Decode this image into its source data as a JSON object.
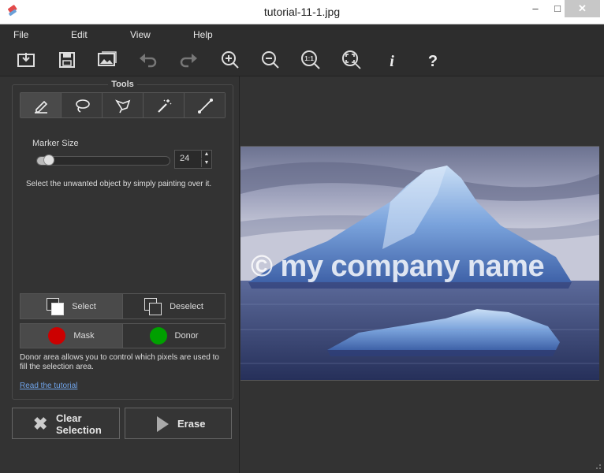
{
  "window": {
    "title": "tutorial-11-1.jpg",
    "minimize": "–",
    "maximize": "□",
    "close": "✕"
  },
  "menu": {
    "file": "File",
    "edit": "Edit",
    "view": "View",
    "help": "Help"
  },
  "toolbar": {
    "buttons": [
      {
        "name": "open-icon"
      },
      {
        "name": "save-icon"
      },
      {
        "name": "image-icon"
      },
      {
        "name": "undo-icon"
      },
      {
        "name": "redo-icon"
      },
      {
        "name": "zoom-in-icon"
      },
      {
        "name": "zoom-out-icon"
      },
      {
        "name": "zoom-actual-icon"
      },
      {
        "name": "zoom-fit-icon"
      },
      {
        "name": "info-icon"
      },
      {
        "name": "help-icon"
      }
    ],
    "zoom_actual_text": "1:1",
    "info_text": "i",
    "help_text": "?"
  },
  "tools": {
    "title": "Tools",
    "items": [
      {
        "name": "marker-tool",
        "icon": "pencil-icon",
        "active": true
      },
      {
        "name": "lasso-tool",
        "icon": "lasso-icon"
      },
      {
        "name": "polygon-lasso-tool",
        "icon": "polygon-lasso-icon"
      },
      {
        "name": "magic-wand-tool",
        "icon": "magic-wand-icon"
      },
      {
        "name": "line-tool",
        "icon": "line-icon"
      }
    ],
    "marker_size_label": "Marker Size",
    "marker_size_value": "24",
    "marker_size_fraction": 0.05,
    "hint": "Select the unwanted object by simply painting over it.",
    "select_label": "Select",
    "deselect_label": "Deselect",
    "mask_label": "Mask",
    "donor_label": "Donor",
    "mask_color": "#cc0000",
    "donor_color": "#00a000",
    "donor_text": "Donor area allows you to control which pixels are used to fill the selection area.",
    "tutorial_link": "Read the tutorial"
  },
  "actions": {
    "clear_line1": "Clear",
    "clear_line2": "Selection",
    "erase": "Erase"
  },
  "image": {
    "watermark": "© my company name"
  }
}
